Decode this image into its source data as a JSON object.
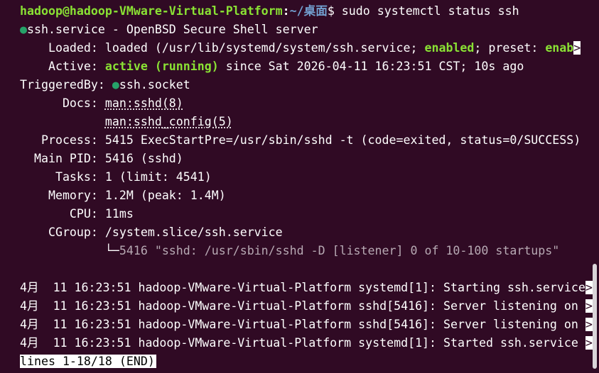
{
  "prompt": {
    "user_host": "hadoop@hadoop-VMware-Virtual-Platform",
    "sep": ":",
    "path": "~/桌面",
    "symbol": "$ ",
    "command": "sudo systemctl status ssh"
  },
  "service": {
    "dot": "●",
    "header": "ssh.service - OpenBSD Secure Shell server",
    "loaded_label": "    Loaded: ",
    "loaded_value_a": "loaded (/usr/lib/systemd/system/ssh.service; ",
    "loaded_enabled": "enabled",
    "loaded_value_b": "; preset: ",
    "loaded_preset": "enab",
    "loaded_more": ">",
    "active_label": "    Active: ",
    "active_state": "active (running)",
    "active_since": " since Sat 2026-04-11 16:23:51 CST; 10s ago",
    "triggered_label": "TriggeredBy: ",
    "triggered_dot": "●",
    "triggered_value": "ssh.socket",
    "docs_label": "      Docs: ",
    "docs_1": "man:sshd(8)",
    "docs_indent": "            ",
    "docs_2": "man:sshd_config(5)",
    "process_label": "   Process: ",
    "process_value": "5415 ExecStartPre=/usr/sbin/sshd -t (code=exited, status=0/SUCCESS)",
    "mainpid_label": "  Main PID: ",
    "mainpid_value": "5416 (sshd)",
    "tasks_label": "     Tasks: ",
    "tasks_value": "1 (limit: 4541)",
    "memory_label": "    Memory: ",
    "memory_value": "1.2M (peak: 1.4M)",
    "cpu_label": "       CPU: ",
    "cpu_value": "11ms",
    "cgroup_label": "    CGroup: ",
    "cgroup_value": "/system.slice/ssh.service",
    "tree_indent": "            ",
    "tree_branch": "└─",
    "tree_value": "5416 \"sshd: /usr/sbin/sshd -D [listener] 0 of 10-100 startups\""
  },
  "logs": [
    {
      "text": "4月  11 16:23:51 hadoop-VMware-Virtual-Platform systemd[1]: Starting ssh.service",
      "more": ">"
    },
    {
      "text": "4月  11 16:23:51 hadoop-VMware-Virtual-Platform sshd[5416]: Server listening on ",
      "more": ">"
    },
    {
      "text": "4月  11 16:23:51 hadoop-VMware-Virtual-Platform sshd[5416]: Server listening on ",
      "more": ">"
    },
    {
      "text": "4月  11 16:23:51 hadoop-VMware-Virtual-Platform systemd[1]: Started ssh.service ",
      "more": ">"
    }
  ],
  "pager_status": "lines 1-18/18 (END)"
}
